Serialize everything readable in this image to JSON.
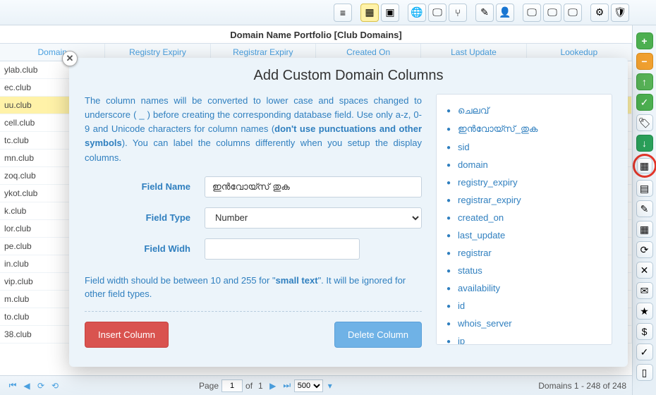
{
  "topToolbar": [
    {
      "name": "menu-icon",
      "glyph": "≡"
    },
    {
      "name": "sep"
    },
    {
      "name": "grid-icon",
      "glyph": "▦",
      "highlight": true
    },
    {
      "name": "note-icon",
      "glyph": "▣"
    },
    {
      "name": "sep"
    },
    {
      "name": "globe-icon",
      "glyph": "🌐"
    },
    {
      "name": "monitor-icon",
      "glyph": "🖵"
    },
    {
      "name": "branch-icon",
      "glyph": "⑂"
    },
    {
      "name": "sep"
    },
    {
      "name": "pencil-icon",
      "glyph": "✎"
    },
    {
      "name": "user-icon",
      "glyph": "👤"
    },
    {
      "name": "sep"
    },
    {
      "name": "monitor2-icon",
      "glyph": "🖵"
    },
    {
      "name": "monitor3-icon",
      "glyph": "🖵"
    },
    {
      "name": "monitor4-icon",
      "glyph": "🖵"
    },
    {
      "name": "sep"
    },
    {
      "name": "gear-icon",
      "glyph": "⚙"
    },
    {
      "name": "shield-icon",
      "glyph": "🛡"
    }
  ],
  "rightSidebar": [
    {
      "name": "add-icon",
      "glyph": "+",
      "cls": "green-plus"
    },
    {
      "name": "remove-icon",
      "glyph": "−",
      "cls": "orange-minus"
    },
    {
      "name": "up-icon",
      "glyph": "↑",
      "cls": "up-green"
    },
    {
      "name": "check-icon",
      "glyph": "✓",
      "cls": "check"
    },
    {
      "name": "tag-icon",
      "glyph": "🏷"
    },
    {
      "name": "down-icon",
      "glyph": "↓",
      "cls": "down-green"
    },
    {
      "name": "add-column-icon",
      "glyph": "▦",
      "highlighted": true
    },
    {
      "name": "list-icon",
      "glyph": "▤"
    },
    {
      "name": "edit-icon",
      "glyph": "✎"
    },
    {
      "name": "report-icon",
      "glyph": "▦"
    },
    {
      "name": "refresh-icon",
      "glyph": "⟳"
    },
    {
      "name": "tools-icon",
      "glyph": "✕"
    },
    {
      "name": "mail-icon",
      "glyph": "✉"
    },
    {
      "name": "star-icon",
      "glyph": "★"
    },
    {
      "name": "money-icon",
      "glyph": "$"
    },
    {
      "name": "approve-icon",
      "glyph": "✓"
    },
    {
      "name": "notebook-icon",
      "glyph": "▯"
    }
  ],
  "portfolioTitle": "Domain Name Portfolio [Club Domains]",
  "gridHeaders": [
    "Domain",
    "Registry Expiry",
    "Registrar Expiry",
    "Created On",
    "Last Update",
    "Lookedup"
  ],
  "gridRows": [
    {
      "d": "ylab.club"
    },
    {
      "d": "ec.club"
    },
    {
      "d": "uu.club",
      "highlight": true
    },
    {
      "d": "cell.club"
    },
    {
      "d": "tc.club"
    },
    {
      "d": "mn.club"
    },
    {
      "d": "zoq.club"
    },
    {
      "d": "ykot.club"
    },
    {
      "d": "k.club"
    },
    {
      "d": "lor.club"
    },
    {
      "d": "pe.club"
    },
    {
      "d": "in.club"
    },
    {
      "d": "vip.club"
    },
    {
      "d": "m.club"
    },
    {
      "d": "to.club"
    },
    {
      "d": "38.club"
    }
  ],
  "footer": {
    "page_label": "Page",
    "page_current": "1",
    "of_label": "of",
    "total_pages": "1",
    "page_size": "500",
    "status": "Domains 1 - 248 of 248"
  },
  "modal": {
    "title": "Add Custom Domain Columns",
    "instruction_pre": "The column names will be converted to lower case and spaces changed to underscore ( _ ) before creating the corresponding database field. Use only a-z, 0-9 and Unicode characters for column names (",
    "instruction_bold": "don't use punctuations and other symbols",
    "instruction_post": "). You can label the columns differently when you setup the display columns.",
    "field_name_label": "Field Name",
    "field_name_value": "ഇൻവോയ്സ് തുക",
    "field_type_label": "Field Type",
    "field_type_value": "Number",
    "field_width_label": "Field Widh",
    "field_width_value": "",
    "hint_pre": "Field width should be between 10 and 255 for \"",
    "hint_bold": "small text",
    "hint_post": "\". It will be ignored for other field types.",
    "insert_label": "Insert Column",
    "delete_label": "Delete Column",
    "columns": [
      "ചെലവ്",
      "ഇൻവോയ്സ്_തുക",
      "sid",
      "domain",
      "registry_expiry",
      "registrar_expiry",
      "created_on",
      "last_update",
      "registrar",
      "status",
      "availability",
      "id",
      "whois_server",
      "ip"
    ]
  }
}
